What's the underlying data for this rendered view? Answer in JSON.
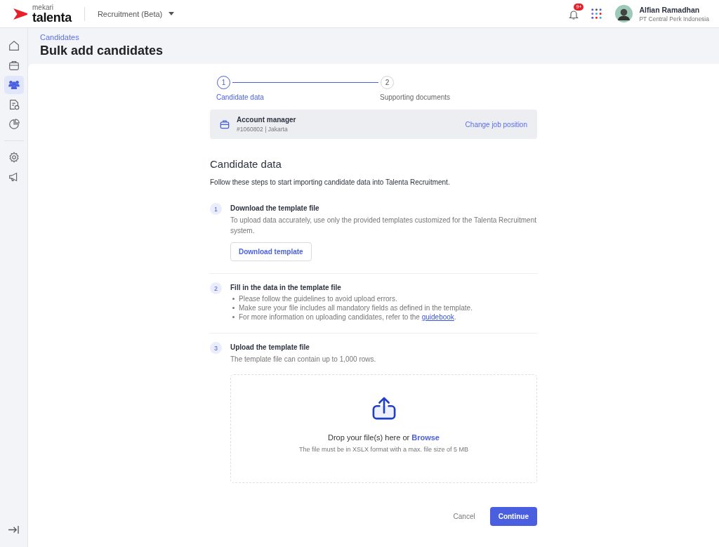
{
  "topbar": {
    "brand_small": "mekari",
    "brand": "talenta",
    "product": "Recruitment (Beta)",
    "notification_badge": "9+",
    "user_name": "Alfian Ramadhan",
    "user_company": "PT Central Perk Indonesia"
  },
  "sidebar": {
    "main_items": [
      {
        "kind": "home",
        "selected": false
      },
      {
        "kind": "briefcase",
        "selected": false
      },
      {
        "kind": "people",
        "selected": true
      },
      {
        "kind": "document",
        "selected": false
      },
      {
        "kind": "chart",
        "selected": false
      }
    ],
    "settings_items": [
      {
        "kind": "gear",
        "selected": false
      },
      {
        "kind": "megaphone",
        "selected": false
      }
    ]
  },
  "breadcrumb": "Candidates",
  "page_title": "Bulk add candidates",
  "stepper": [
    {
      "number": "1",
      "label": "Candidate data",
      "selected": true
    },
    {
      "number": "2",
      "label": "Supporting documents",
      "selected": false
    }
  ],
  "job": {
    "title": "Account manager",
    "meta": "#1060802 | Jakarta",
    "action": "Change job position"
  },
  "section_title": "Candidate data",
  "intro": "Follow these steps to start importing candidate data into Talenta Recruitment.",
  "steps": [
    {
      "kind": "download",
      "number": "1",
      "title": "Download the template file",
      "description": "To upload data accurately, use only the provided templates customized for the Talenta Recruitment system.",
      "button": "Download template"
    },
    {
      "kind": "bullets",
      "number": "2",
      "title": "Fill in the data in the template file",
      "bullets": [
        {
          "text": "Please follow the guidelines to avoid upload errors."
        },
        {
          "text": "Make sure your file includes all mandatory fields as defined in the template."
        },
        {
          "text": "For more information on uploading candidates, refer to the ",
          "link": "guidebook",
          "after": "."
        }
      ]
    },
    {
      "kind": "upload",
      "number": "3",
      "title": "Upload the template file",
      "description": "The template file can contain up to 1,000 rows.",
      "drop_text": "Drop your file(s) here or ",
      "drop_link": "Browse",
      "drop_hint": "The file must be in XSLX format with a max. file size of 5 MB"
    }
  ],
  "actions": {
    "cancel": "Cancel",
    "continue": "Continue"
  }
}
